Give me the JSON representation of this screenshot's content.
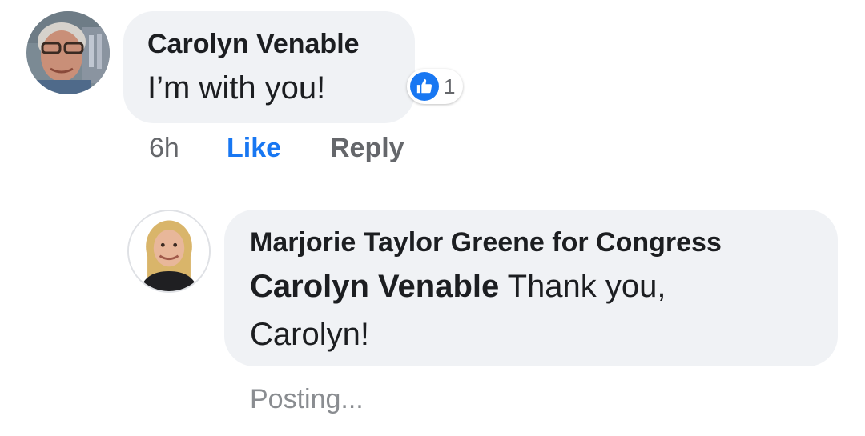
{
  "comment": {
    "author": "Carolyn Venable",
    "text": "I’m with you!",
    "reaction_count": "1",
    "time": "6h",
    "like_label": "Like",
    "reply_label": "Reply"
  },
  "reply": {
    "author": "Marjorie Taylor Greene for Congress",
    "mention": "Carolyn Venable",
    "text_after_mention": " Thank you,",
    "text_line2": "Carolyn!",
    "status": "Posting..."
  },
  "colors": {
    "bubble": "#f0f2f5",
    "link_blue": "#1877f2",
    "meta_gray": "#65676b"
  },
  "icons": {
    "reaction": "thumbs-up-icon"
  }
}
